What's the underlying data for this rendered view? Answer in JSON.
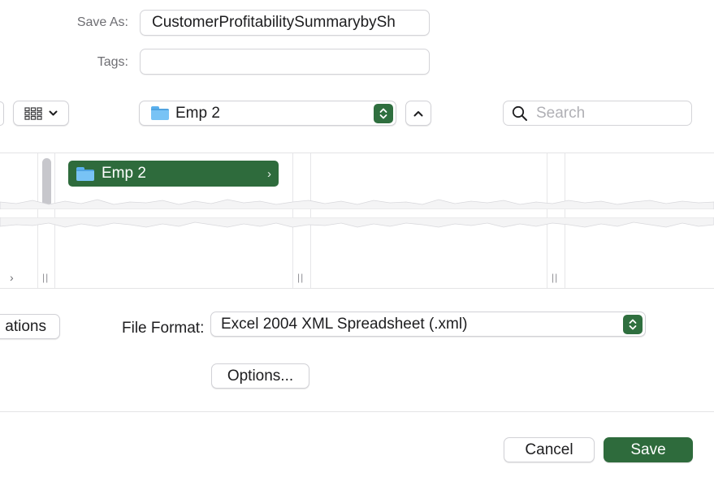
{
  "save_as": {
    "label": "Save As:",
    "value": "CustomerProfitabilitySummarybySh"
  },
  "tags": {
    "label": "Tags:",
    "value": ""
  },
  "toolbar": {
    "view_icon": "icon-grid-icon",
    "location": "Emp 2",
    "search_placeholder": "Search"
  },
  "browser": {
    "selected_item": "Emp 2",
    "left_chevron": "›",
    "item_chevron": "›"
  },
  "options": {
    "partial_button": "ations",
    "file_format_label": "File Format:",
    "file_format_value": "Excel 2004 XML Spreadsheet (.xml)",
    "options_button": "Options..."
  },
  "footer": {
    "cancel": "Cancel",
    "save": "Save"
  },
  "colors": {
    "accent": "#2e6b3c"
  }
}
